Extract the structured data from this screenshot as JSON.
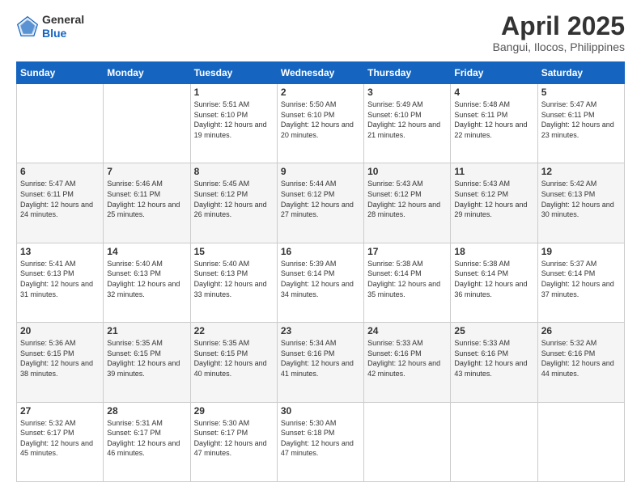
{
  "header": {
    "logo_line1": "General",
    "logo_line2": "Blue",
    "month_title": "April 2025",
    "location": "Bangui, Ilocos, Philippines"
  },
  "days_of_week": [
    "Sunday",
    "Monday",
    "Tuesday",
    "Wednesday",
    "Thursday",
    "Friday",
    "Saturday"
  ],
  "weeks": [
    [
      {
        "day": "",
        "sunrise": "",
        "sunset": "",
        "daylight": ""
      },
      {
        "day": "",
        "sunrise": "",
        "sunset": "",
        "daylight": ""
      },
      {
        "day": "1",
        "sunrise": "Sunrise: 5:51 AM",
        "sunset": "Sunset: 6:10 PM",
        "daylight": "Daylight: 12 hours and 19 minutes."
      },
      {
        "day": "2",
        "sunrise": "Sunrise: 5:50 AM",
        "sunset": "Sunset: 6:10 PM",
        "daylight": "Daylight: 12 hours and 20 minutes."
      },
      {
        "day": "3",
        "sunrise": "Sunrise: 5:49 AM",
        "sunset": "Sunset: 6:10 PM",
        "daylight": "Daylight: 12 hours and 21 minutes."
      },
      {
        "day": "4",
        "sunrise": "Sunrise: 5:48 AM",
        "sunset": "Sunset: 6:11 PM",
        "daylight": "Daylight: 12 hours and 22 minutes."
      },
      {
        "day": "5",
        "sunrise": "Sunrise: 5:47 AM",
        "sunset": "Sunset: 6:11 PM",
        "daylight": "Daylight: 12 hours and 23 minutes."
      }
    ],
    [
      {
        "day": "6",
        "sunrise": "Sunrise: 5:47 AM",
        "sunset": "Sunset: 6:11 PM",
        "daylight": "Daylight: 12 hours and 24 minutes."
      },
      {
        "day": "7",
        "sunrise": "Sunrise: 5:46 AM",
        "sunset": "Sunset: 6:11 PM",
        "daylight": "Daylight: 12 hours and 25 minutes."
      },
      {
        "day": "8",
        "sunrise": "Sunrise: 5:45 AM",
        "sunset": "Sunset: 6:12 PM",
        "daylight": "Daylight: 12 hours and 26 minutes."
      },
      {
        "day": "9",
        "sunrise": "Sunrise: 5:44 AM",
        "sunset": "Sunset: 6:12 PM",
        "daylight": "Daylight: 12 hours and 27 minutes."
      },
      {
        "day": "10",
        "sunrise": "Sunrise: 5:43 AM",
        "sunset": "Sunset: 6:12 PM",
        "daylight": "Daylight: 12 hours and 28 minutes."
      },
      {
        "day": "11",
        "sunrise": "Sunrise: 5:43 AM",
        "sunset": "Sunset: 6:12 PM",
        "daylight": "Daylight: 12 hours and 29 minutes."
      },
      {
        "day": "12",
        "sunrise": "Sunrise: 5:42 AM",
        "sunset": "Sunset: 6:13 PM",
        "daylight": "Daylight: 12 hours and 30 minutes."
      }
    ],
    [
      {
        "day": "13",
        "sunrise": "Sunrise: 5:41 AM",
        "sunset": "Sunset: 6:13 PM",
        "daylight": "Daylight: 12 hours and 31 minutes."
      },
      {
        "day": "14",
        "sunrise": "Sunrise: 5:40 AM",
        "sunset": "Sunset: 6:13 PM",
        "daylight": "Daylight: 12 hours and 32 minutes."
      },
      {
        "day": "15",
        "sunrise": "Sunrise: 5:40 AM",
        "sunset": "Sunset: 6:13 PM",
        "daylight": "Daylight: 12 hours and 33 minutes."
      },
      {
        "day": "16",
        "sunrise": "Sunrise: 5:39 AM",
        "sunset": "Sunset: 6:14 PM",
        "daylight": "Daylight: 12 hours and 34 minutes."
      },
      {
        "day": "17",
        "sunrise": "Sunrise: 5:38 AM",
        "sunset": "Sunset: 6:14 PM",
        "daylight": "Daylight: 12 hours and 35 minutes."
      },
      {
        "day": "18",
        "sunrise": "Sunrise: 5:38 AM",
        "sunset": "Sunset: 6:14 PM",
        "daylight": "Daylight: 12 hours and 36 minutes."
      },
      {
        "day": "19",
        "sunrise": "Sunrise: 5:37 AM",
        "sunset": "Sunset: 6:14 PM",
        "daylight": "Daylight: 12 hours and 37 minutes."
      }
    ],
    [
      {
        "day": "20",
        "sunrise": "Sunrise: 5:36 AM",
        "sunset": "Sunset: 6:15 PM",
        "daylight": "Daylight: 12 hours and 38 minutes."
      },
      {
        "day": "21",
        "sunrise": "Sunrise: 5:35 AM",
        "sunset": "Sunset: 6:15 PM",
        "daylight": "Daylight: 12 hours and 39 minutes."
      },
      {
        "day": "22",
        "sunrise": "Sunrise: 5:35 AM",
        "sunset": "Sunset: 6:15 PM",
        "daylight": "Daylight: 12 hours and 40 minutes."
      },
      {
        "day": "23",
        "sunrise": "Sunrise: 5:34 AM",
        "sunset": "Sunset: 6:16 PM",
        "daylight": "Daylight: 12 hours and 41 minutes."
      },
      {
        "day": "24",
        "sunrise": "Sunrise: 5:33 AM",
        "sunset": "Sunset: 6:16 PM",
        "daylight": "Daylight: 12 hours and 42 minutes."
      },
      {
        "day": "25",
        "sunrise": "Sunrise: 5:33 AM",
        "sunset": "Sunset: 6:16 PM",
        "daylight": "Daylight: 12 hours and 43 minutes."
      },
      {
        "day": "26",
        "sunrise": "Sunrise: 5:32 AM",
        "sunset": "Sunset: 6:16 PM",
        "daylight": "Daylight: 12 hours and 44 minutes."
      }
    ],
    [
      {
        "day": "27",
        "sunrise": "Sunrise: 5:32 AM",
        "sunset": "Sunset: 6:17 PM",
        "daylight": "Daylight: 12 hours and 45 minutes."
      },
      {
        "day": "28",
        "sunrise": "Sunrise: 5:31 AM",
        "sunset": "Sunset: 6:17 PM",
        "daylight": "Daylight: 12 hours and 46 minutes."
      },
      {
        "day": "29",
        "sunrise": "Sunrise: 5:30 AM",
        "sunset": "Sunset: 6:17 PM",
        "daylight": "Daylight: 12 hours and 47 minutes."
      },
      {
        "day": "30",
        "sunrise": "Sunrise: 5:30 AM",
        "sunset": "Sunset: 6:18 PM",
        "daylight": "Daylight: 12 hours and 47 minutes."
      },
      {
        "day": "",
        "sunrise": "",
        "sunset": "",
        "daylight": ""
      },
      {
        "day": "",
        "sunrise": "",
        "sunset": "",
        "daylight": ""
      },
      {
        "day": "",
        "sunrise": "",
        "sunset": "",
        "daylight": ""
      }
    ]
  ]
}
